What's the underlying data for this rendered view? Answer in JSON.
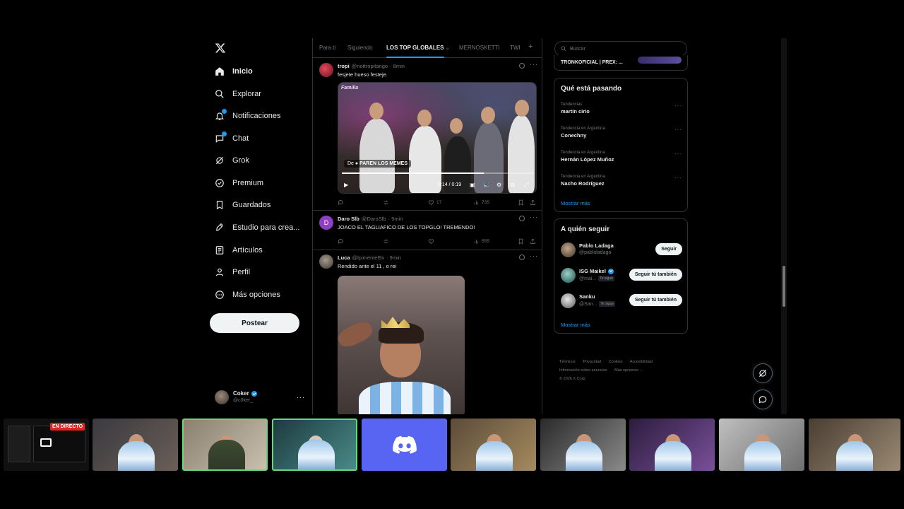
{
  "nav": {
    "items": [
      {
        "label": "Inicio",
        "icon": "home-icon"
      },
      {
        "label": "Explorar",
        "icon": "search-icon"
      },
      {
        "label": "Notificaciones",
        "icon": "bell-icon"
      },
      {
        "label": "Chat",
        "icon": "chat-icon"
      },
      {
        "label": "Grok",
        "icon": "grok-icon"
      },
      {
        "label": "Premium",
        "icon": "premium-icon"
      },
      {
        "label": "Guardados",
        "icon": "bookmark-icon"
      },
      {
        "label": "Estudio para crea...",
        "icon": "rocket-icon"
      },
      {
        "label": "Artículos",
        "icon": "article-icon"
      },
      {
        "label": "Perfil",
        "icon": "person-icon"
      },
      {
        "label": "Más opciones",
        "icon": "more-circle-icon"
      }
    ],
    "post_label": "Postear",
    "account": {
      "name": "Coker",
      "handle": "@c0ker_",
      "more": "···"
    }
  },
  "tabs": [
    "Para ti",
    "Siguiendo",
    "LOS TOP GLOBALES",
    "MERNOSKETTI",
    "TWI"
  ],
  "tweets": [
    {
      "name": "tropi",
      "handle": "@nottropitango",
      "time": "· 8min",
      "text": "fesjete hueso festeje.",
      "video": {
        "tag_prefix": "De",
        "tag_text": "PAREN LOS MEMES",
        "time": "0:14 / 0:19",
        "brand": "Familia",
        "progress": 0.74
      },
      "likes": "17",
      "views": "735"
    },
    {
      "name": "Daro Slb",
      "handle": "@DaroSlb",
      "time": "· 9min",
      "avatar_letter": "D",
      "text": "JOACO EL TAGLIAFICO DE LOS TOPGLO! TREMENDO!",
      "views": "555"
    },
    {
      "name": "Luca",
      "handle": "@lpimentel9x",
      "time": "· 9min",
      "text": "Rendido ante el 11 , o rei"
    }
  ],
  "search": {
    "placeholder": "Buscar"
  },
  "top_clip": "TRONKOFICIAL | PREX: ...",
  "trends": {
    "title": "Qué está pasando",
    "items": [
      {
        "category": "Tendencias",
        "name": "martin cirio"
      },
      {
        "category": "Tendencia en Argentina",
        "name": "Conechny"
      },
      {
        "category": "Tendencia en Argentina",
        "name": "Hernán López Muñoz"
      },
      {
        "category": "Tendencia en Argentina",
        "name": "Nacho Rodríguez"
      }
    ],
    "show_more": "Mostrar más"
  },
  "who_to_follow": {
    "title": "A quién seguir",
    "items": [
      {
        "name": "Pablo Ladaga",
        "handle": "@pabloladaga",
        "button": "Seguir",
        "verified": false,
        "follows_you": ""
      },
      {
        "name": "ISG Maikel",
        "handle": "@mai...",
        "button": "Seguir tú también",
        "verified": true,
        "follows_you": "Te sigue"
      },
      {
        "name": "Sanku",
        "handle": "@San...",
        "button": "Seguir tú también",
        "verified": false,
        "follows_you": "Te sigue"
      }
    ],
    "show_more": "Mostrar más"
  },
  "footer": {
    "links": [
      "Términos",
      "Privacidad",
      "Cookies",
      "Accesibilidad",
      "Información sobre anuncios",
      "Más opciones ···"
    ],
    "copyright": "© 2026 X Corp."
  },
  "stream": {
    "live_label": "EN DIRECTO"
  },
  "colors": {
    "accent": "#1d9bf0",
    "background": "#000000",
    "text": "#e7e9ea",
    "muted": "#71767b",
    "live": "#e02424",
    "discord": "#5865f2"
  }
}
